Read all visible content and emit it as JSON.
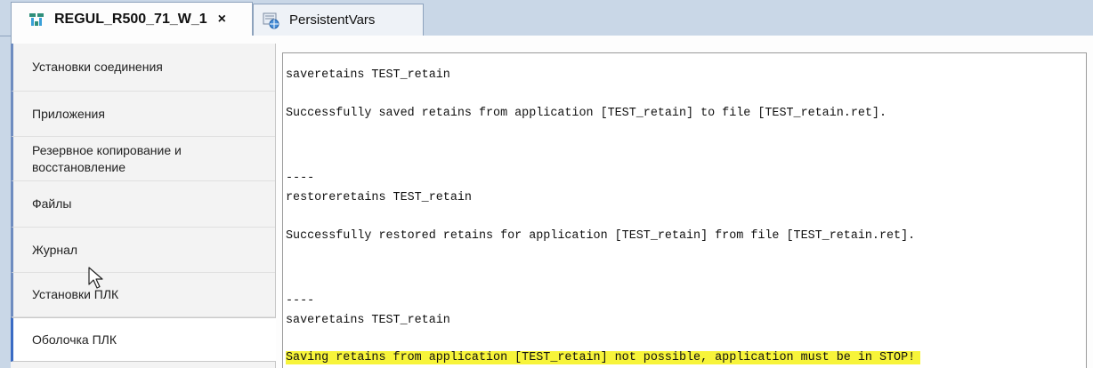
{
  "tabs": [
    {
      "label": "REGUL_R500_71_W_1",
      "close": "×",
      "icon": "device-tree-icon",
      "active": true
    },
    {
      "label": "PersistentVars",
      "icon": "global-vars-icon",
      "active": false
    }
  ],
  "sidebar": {
    "items": [
      {
        "label": "Установки соединения"
      },
      {
        "label": "Приложения"
      },
      {
        "label": "Резервное копирование и восстановление"
      },
      {
        "label": "Файлы"
      },
      {
        "label": "Журнал"
      },
      {
        "label": "Установки ПЛК"
      },
      {
        "label": "Оболочка ПЛК",
        "selected": true
      }
    ]
  },
  "console": {
    "lines": [
      "saveretains TEST_retain",
      "Successfully saved retains from application [TEST_retain] to file [TEST_retain.ret].",
      "----",
      "restoreretains TEST_retain",
      "Successfully restored retains for application [TEST_retain] from file [TEST_retain.ret].",
      "----",
      "saveretains TEST_retain",
      "Saving retains from application [TEST_retain] not possible, application must be in STOP!"
    ],
    "highlight_color": "#f7f43a"
  },
  "colors": {
    "tab_strip": "#c9d7e7",
    "sidebar_accent": "#3a6bc4"
  }
}
